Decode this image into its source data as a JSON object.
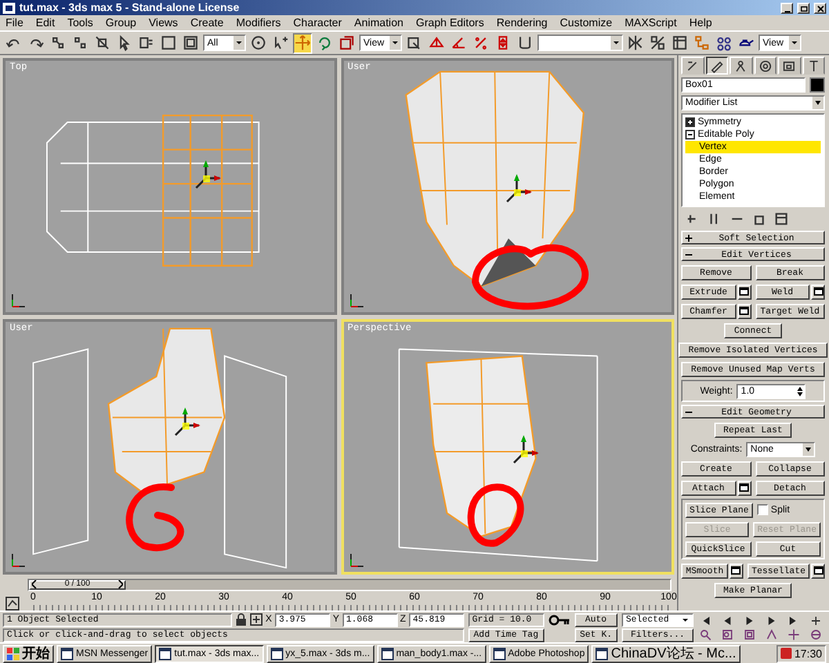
{
  "window": {
    "title": "tut.max - 3ds max 5 - Stand-alone License"
  },
  "menu": [
    "File",
    "Edit",
    "Tools",
    "Group",
    "Views",
    "Create",
    "Modifiers",
    "Character",
    "Animation",
    "Graph Editors",
    "Rendering",
    "Customize",
    "MAXScript",
    "Help"
  ],
  "toolbar": [
    {
      "kind": "button",
      "selected": false
    },
    {
      "kind": "button",
      "selected": false
    },
    {
      "kind": "button",
      "selected": false
    },
    {
      "kind": "button",
      "selected": false
    },
    {
      "kind": "button",
      "selected": false
    },
    {
      "kind": "button",
      "selected": false
    },
    {
      "kind": "button",
      "selected": false
    },
    {
      "kind": "button",
      "selected": false
    },
    {
      "kind": "button",
      "selected": false
    },
    {
      "kind": "dropdown",
      "value": "All"
    },
    {
      "kind": "button",
      "selected": false
    },
    {
      "kind": "button",
      "selected": false
    },
    {
      "kind": "button",
      "selected": true
    },
    {
      "kind": "button",
      "selected": false
    },
    {
      "kind": "button",
      "selected": false
    },
    {
      "kind": "dropdown",
      "value": "View"
    },
    {
      "kind": "button",
      "selected": false
    },
    {
      "kind": "button",
      "selected": false
    },
    {
      "kind": "button",
      "selected": false
    },
    {
      "kind": "button",
      "selected": false
    },
    {
      "kind": "button",
      "selected": false
    },
    {
      "kind": "button",
      "selected": false
    },
    {
      "kind": "dropdown"
    },
    {
      "kind": "button",
      "selected": false
    },
    {
      "kind": "button",
      "selected": false
    },
    {
      "kind": "button",
      "selected": false
    },
    {
      "kind": "button",
      "selected": false
    },
    {
      "kind": "button",
      "selected": false
    },
    {
      "kind": "button",
      "selected": false
    },
    {
      "kind": "dropdown",
      "value": "View"
    }
  ],
  "viewports": [
    {
      "label": "Top",
      "active": false,
      "circled": false
    },
    {
      "label": "User",
      "active": false,
      "circled": true
    },
    {
      "label": "User",
      "active": false,
      "circled": true
    },
    {
      "label": "Perspective",
      "active": true,
      "circled": true
    }
  ],
  "timeline": {
    "position": "0 / 100",
    "level": 0,
    "ruler_labels": [
      "0",
      "10",
      "20",
      "30",
      "40",
      "50",
      "60",
      "70",
      "80",
      "90",
      "100"
    ]
  },
  "command_panel": {
    "tabs": [
      {
        "selected": false
      },
      {
        "selected": true
      },
      {
        "selected": false
      },
      {
        "selected": false
      },
      {
        "selected": false
      },
      {
        "selected": false
      }
    ],
    "object_name": "Box01",
    "modifier_list": "Modifier List",
    "stack": [
      {
        "label": "Symmetry",
        "expanded": false
      },
      {
        "label": "Editable Poly",
        "expanded": true,
        "children": [
          {
            "label": "Vertex",
            "selected": true
          },
          {
            "label": "Edge",
            "selected": false
          },
          {
            "label": "Border",
            "selected": false
          },
          {
            "label": "Polygon",
            "selected": false
          },
          {
            "label": "Element",
            "selected": false
          }
        ]
      }
    ],
    "rollouts": [
      {
        "title": "Soft Selection",
        "expanded": false
      },
      {
        "title": "Edit Vertices",
        "expanded": true,
        "rows": [
          {
            "kind": "row",
            "items": [
              {
                "kind": "button",
                "label": "Remove",
                "settings": false
              },
              {
                "kind": "button",
                "label": "Break",
                "settings": false
              }
            ]
          },
          {
            "kind": "row",
            "items": [
              {
                "kind": "button",
                "label": "Extrude",
                "settings": true
              },
              {
                "kind": "button",
                "label": "Weld",
                "settings": true
              }
            ]
          },
          {
            "kind": "row",
            "items": [
              {
                "kind": "button",
                "label": "Chamfer",
                "settings": true
              },
              {
                "kind": "button",
                "label": "Target Weld",
                "settings": false
              }
            ]
          },
          {
            "kind": "row",
            "items": [
              {
                "kind": "button",
                "label": "Connect"
              }
            ]
          },
          {
            "kind": "row",
            "items": [
              {
                "kind": "button",
                "label": "Remove Isolated Vertices"
              }
            ]
          },
          {
            "kind": "row",
            "items": [
              {
                "kind": "button",
                "label": "Remove Unused Map Verts"
              }
            ]
          },
          {
            "kind": "group",
            "rows": [
              {
                "items": [
                  {
                    "kind": "spinner",
                    "label": "Weight:",
                    "value": "1.0"
                  }
                ]
              }
            ]
          }
        ]
      },
      {
        "title": "Edit Geometry",
        "expanded": true,
        "rows": [
          {
            "kind": "row",
            "items": [
              {
                "kind": "button",
                "label": "Repeat Last"
              }
            ]
          },
          {
            "kind": "row",
            "items": [
              {
                "kind": "dropdown",
                "label": "Constraints:",
                "value": "None"
              }
            ]
          },
          {
            "kind": "row",
            "items": [
              {
                "kind": "button",
                "label": "Create",
                "settings": false
              },
              {
                "kind": "button",
                "label": "Collapse",
                "settings": false
              }
            ]
          },
          {
            "kind": "row",
            "items": [
              {
                "kind": "button",
                "label": "Attach",
                "settings": true
              },
              {
                "kind": "button",
                "label": "Detach",
                "settings": false
              }
            ]
          },
          {
            "kind": "group",
            "rows": [
              {
                "items": [
                  {
                    "kind": "button",
                    "label": "Slice Plane"
                  },
                  {
                    "kind": "checkbox",
                    "label": "Split",
                    "checked": false
                  }
                ]
              },
              {
                "items": [
                  {
                    "kind": "button",
                    "label": "Slice",
                    "disabled": true
                  },
                  {
                    "kind": "button",
                    "label": "Reset Plane",
                    "disabled": true
                  }
                ]
              },
              {
                "items": [
                  {
                    "kind": "button",
                    "label": "QuickSlice"
                  },
                  {
                    "kind": "button",
                    "label": "Cut"
                  }
                ]
              }
            ]
          },
          {
            "kind": "row",
            "items": [
              {
                "kind": "button",
                "label": "MSmooth",
                "settings": true
              },
              {
                "kind": "button",
                "label": "Tessellate",
                "settings": true
              }
            ]
          },
          {
            "kind": "row",
            "items": [
              {
                "kind": "button",
                "label": "Make Planar"
              }
            ]
          }
        ]
      }
    ]
  },
  "status": {
    "selection": "1 Object Selected",
    "prompt": "Click or click-and-drag to select objects",
    "coordinates": [
      {
        "axis": "X",
        "value": "3.975"
      },
      {
        "axis": "Y",
        "value": "1.068"
      },
      {
        "axis": "Z",
        "value": "45.819"
      }
    ],
    "grid": "Grid = 10.0",
    "add_time_tag": "Add Time Tag",
    "auto_key": "Auto",
    "set_key": "Set K.",
    "key_filter": "Selected",
    "filters": "Filters..."
  },
  "taskbar": {
    "start": "开始",
    "tasks": [
      {
        "label": "MSN Messenger",
        "selected": false
      },
      {
        "label": "tut.max - 3ds max...",
        "selected": true
      },
      {
        "label": "yx_5.max - 3ds m...",
        "selected": false
      },
      {
        "label": "man_body1.max -...",
        "selected": false
      },
      {
        "label": "Adobe Photoshop",
        "selected": false
      },
      {
        "label": "ChinaDV论坛 - Mc...",
        "selected": false
      }
    ],
    "clock": "17:30"
  }
}
